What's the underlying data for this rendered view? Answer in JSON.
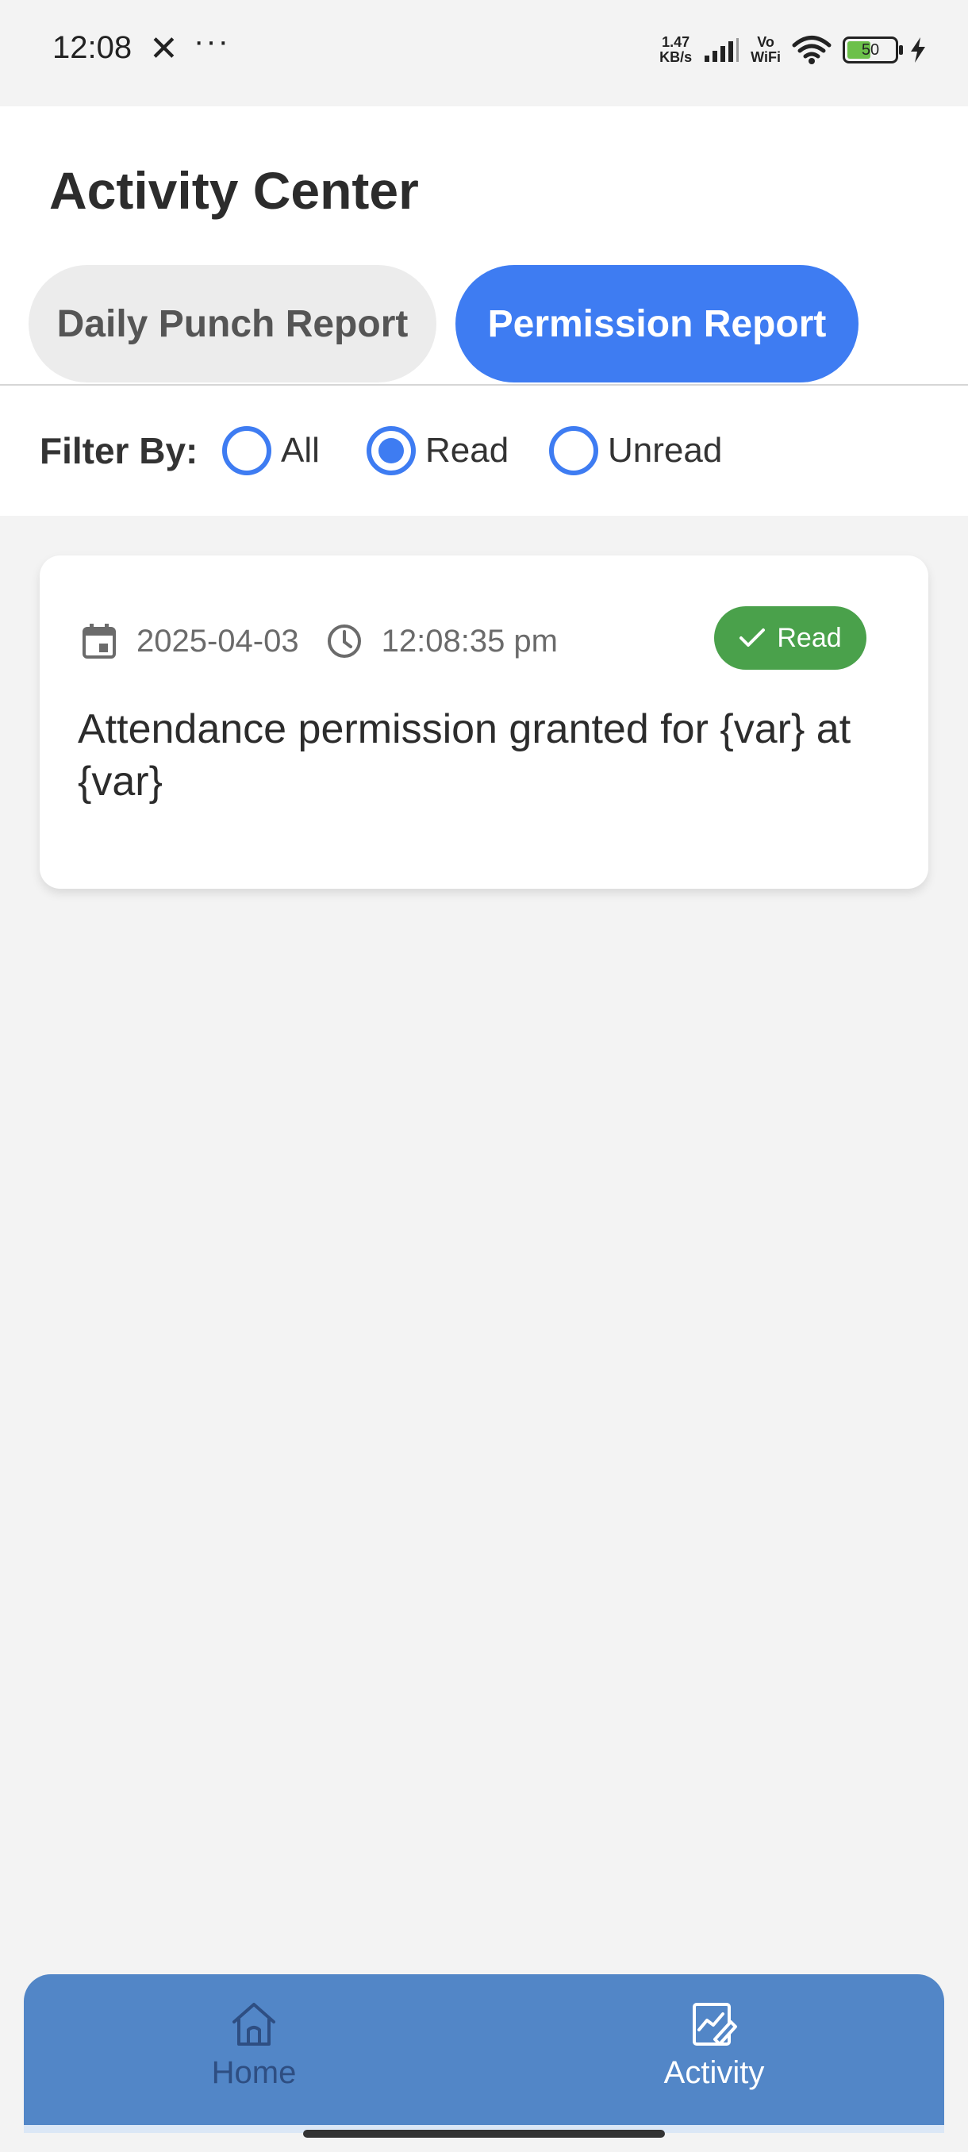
{
  "status_bar": {
    "time": "12:08",
    "x_glyph": "✕",
    "dots": "···",
    "net_speed_value": "1.47",
    "net_speed_unit": "KB/s",
    "vowifi_top": "Vo",
    "vowifi_bottom": "WiFi",
    "battery": "50"
  },
  "header": {
    "title": "Activity Center",
    "tabs": [
      {
        "label": "Daily Punch Report",
        "active": false
      },
      {
        "label": "Permission Report",
        "active": true
      }
    ]
  },
  "filter": {
    "label": "Filter By:",
    "options": [
      {
        "label": "All",
        "selected": false
      },
      {
        "label": "Read",
        "selected": true
      },
      {
        "label": "Unread",
        "selected": false
      }
    ]
  },
  "notifications": [
    {
      "date": "2025-04-03",
      "time": "12:08:35 pm",
      "status": "Read",
      "message": "Attendance permission granted for {var} at {var}"
    }
  ],
  "bottom_nav": {
    "items": [
      {
        "label": "Home",
        "icon": "home-icon",
        "active": false
      },
      {
        "label": "Activity",
        "icon": "activity-icon",
        "active": true
      }
    ]
  },
  "colors": {
    "accent": "#3e7cf2",
    "read_badge": "#4aa14b",
    "nav_bg": "#5286c7"
  }
}
